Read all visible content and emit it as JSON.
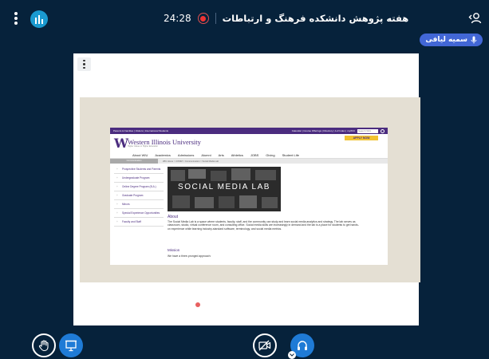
{
  "header": {
    "timer": "24:28",
    "meeting_title": "هفته پژوهش دانشکده فرهنگ و ارتباطات",
    "user_name": "سمیه لیافی"
  },
  "slide": {
    "site": {
      "utility_left": "Parents & Families  |  Visitors  |  International Students",
      "utility_right": "Calendar  |  Course Offerings  |  Directory  |  A-Z Index  |  myWIU",
      "search_placeholder": "Search WIU",
      "logo_letter": "W",
      "university_name": "Western Illinois University",
      "tagline": "Higher Values in Higher Education",
      "apply_label": "APPLY NOW",
      "nav": [
        "About WIU",
        "Academics",
        "Admissions",
        "Alumni",
        "Arts",
        "Athletics",
        "JOBS",
        "Giving",
        "Student Life"
      ],
      "crumb_tab": "Communication",
      "breadcrumb": "WIU Home > COMM > Communication > Social Media Lab",
      "sidebar": [
        "Prospective Students and Parents",
        "Undergraduate Program",
        "Online Degree Program (B.A.)",
        "Graduate Program",
        "Minors",
        "Special Experience Opportunities",
        "Faculty and Staff"
      ],
      "hero_text": "SOCIAL MEDIA LAB",
      "about_heading": "About",
      "about_text": "The Social Media Lab is a space where students, faculty, staff, and the community can study and learn social media analytics and strategy. The lab serves as classroom, studio, virtual conference room, and consulting office. Social media skills are increasingly in demand and the lab is a place for students to get hands-on experience while learning industry-standard software, terminology, and social media metrics.",
      "mission_heading": "Mission",
      "mission_text": "We have a three-pronged approach:"
    }
  },
  "controls": {
    "raise_hand": "raise-hand-icon",
    "presentation": "presentation-icon",
    "video": "video-off-icon",
    "audio": "headphones-icon"
  },
  "colors": {
    "background": "#06223b",
    "accent": "#1f7bd6",
    "badge": "#4267d6",
    "record": "#e33333",
    "wiu_purple": "#4b2c7f",
    "wiu_gold": "#f1c232"
  }
}
